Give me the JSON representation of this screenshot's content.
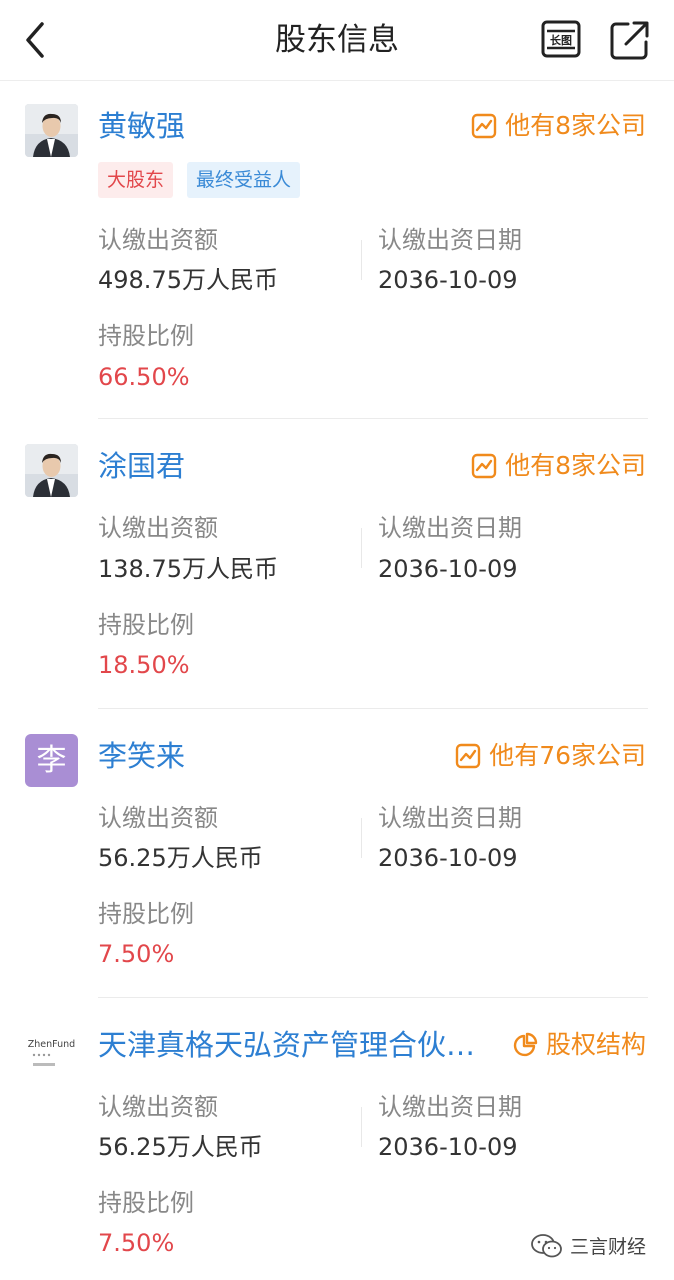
{
  "header": {
    "title": "股东信息",
    "longshot_icon_text": "长图"
  },
  "shareholders": [
    {
      "name": "黄敏强",
      "link_label": "他有8家公司",
      "link_icon": "chart-icon",
      "avatar_type": "photo",
      "tags": [
        "大股东",
        "最终受益人"
      ],
      "subscribed_amount_label": "认缴出资额",
      "subscribed_amount": "498.75万人民币",
      "subscribed_date_label": "认缴出资日期",
      "subscribed_date": "2036-10-09",
      "ratio_label": "持股比例",
      "ratio": "66.50%"
    },
    {
      "name": "涂国君",
      "link_label": "他有8家公司",
      "link_icon": "chart-icon",
      "avatar_type": "photo",
      "subscribed_amount_label": "认缴出资额",
      "subscribed_amount": "138.75万人民币",
      "subscribed_date_label": "认缴出资日期",
      "subscribed_date": "2036-10-09",
      "ratio_label": "持股比例",
      "ratio": "18.50%"
    },
    {
      "name": "李笑来",
      "link_label": "他有76家公司",
      "link_icon": "chart-icon",
      "avatar_type": "letter",
      "avatar_letter": "李",
      "subscribed_amount_label": "认缴出资额",
      "subscribed_amount": "56.25万人民币",
      "subscribed_date_label": "认缴出资日期",
      "subscribed_date": "2036-10-09",
      "ratio_label": "持股比例",
      "ratio": "7.50%"
    },
    {
      "name": "天津真格天弘资产管理合伙…",
      "link_label": "股权结构",
      "link_icon": "pie-chart-icon",
      "avatar_type": "logo",
      "avatar_logo_text": "ZhenFund",
      "subscribed_amount_label": "认缴出资额",
      "subscribed_amount": "56.25万人民币",
      "subscribed_date_label": "认缴出资日期",
      "subscribed_date": "2036-10-09",
      "ratio_label": "持股比例",
      "ratio": "7.50%"
    }
  ],
  "watermark": {
    "text": "三言财经"
  },
  "colors": {
    "name_blue": "#2d7fd2",
    "link_orange": "#f08a1c",
    "ratio_red": "#e2474b",
    "label_gray": "#888888"
  }
}
